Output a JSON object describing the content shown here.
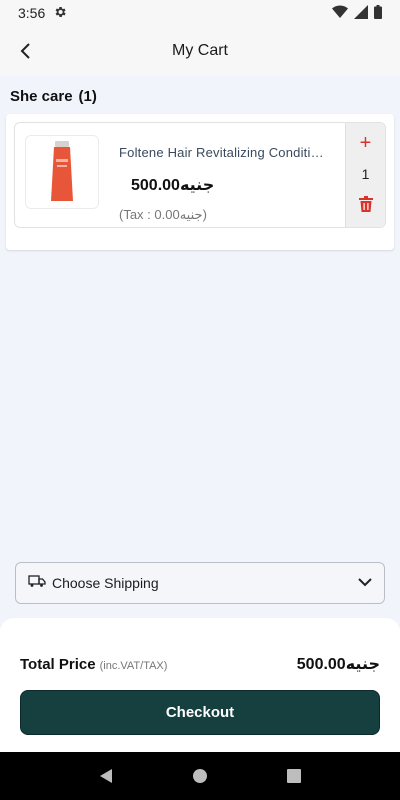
{
  "status_bar": {
    "time": "3:56",
    "icons": [
      "gear-icon",
      "wifi-icon",
      "signal-icon",
      "battery-icon"
    ]
  },
  "app_bar": {
    "title": "My Cart",
    "back_icon": "arrow-left-icon"
  },
  "store": {
    "name": "She care",
    "count": "(1)"
  },
  "cart_items": [
    {
      "name": "Foltene Hair Revitalizing Conditioner",
      "price": "500.00جنيه",
      "tax": "(Tax : 0.00جنيه)",
      "quantity": "1",
      "plus_label": "+",
      "product_color": "#e8563a"
    }
  ],
  "shipping": {
    "label": "Choose Shipping",
    "icon": "truck-icon"
  },
  "total": {
    "label": "Total Price",
    "sub_label": "(inc.VAT/TAX)",
    "value": "500.00جنيه"
  },
  "checkout": {
    "label": "Checkout"
  },
  "colors": {
    "accent": "#163f40",
    "danger": "#d9342b",
    "background": "#f1f5fb"
  }
}
